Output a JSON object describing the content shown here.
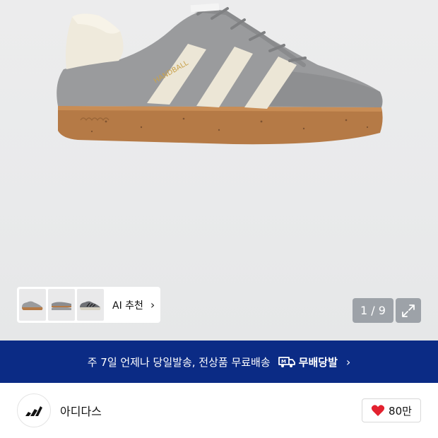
{
  "image_gallery": {
    "ai_recommend_label": "AI 추천",
    "counter": "1 / 9",
    "thumbnails": [
      "gray-sneaker-side",
      "gray-sneaker-pair",
      "gray-sneaker-top"
    ]
  },
  "banner": {
    "text": "주 7일 언제나 당일발송, 전상품 무료배송",
    "badge_label": "무배당발",
    "background": "#0b2b85"
  },
  "brand": {
    "name": "아디다스",
    "logo": "adidas-logo"
  },
  "like": {
    "count": "80만",
    "icon": "heart-icon",
    "color": "#e3212f"
  }
}
